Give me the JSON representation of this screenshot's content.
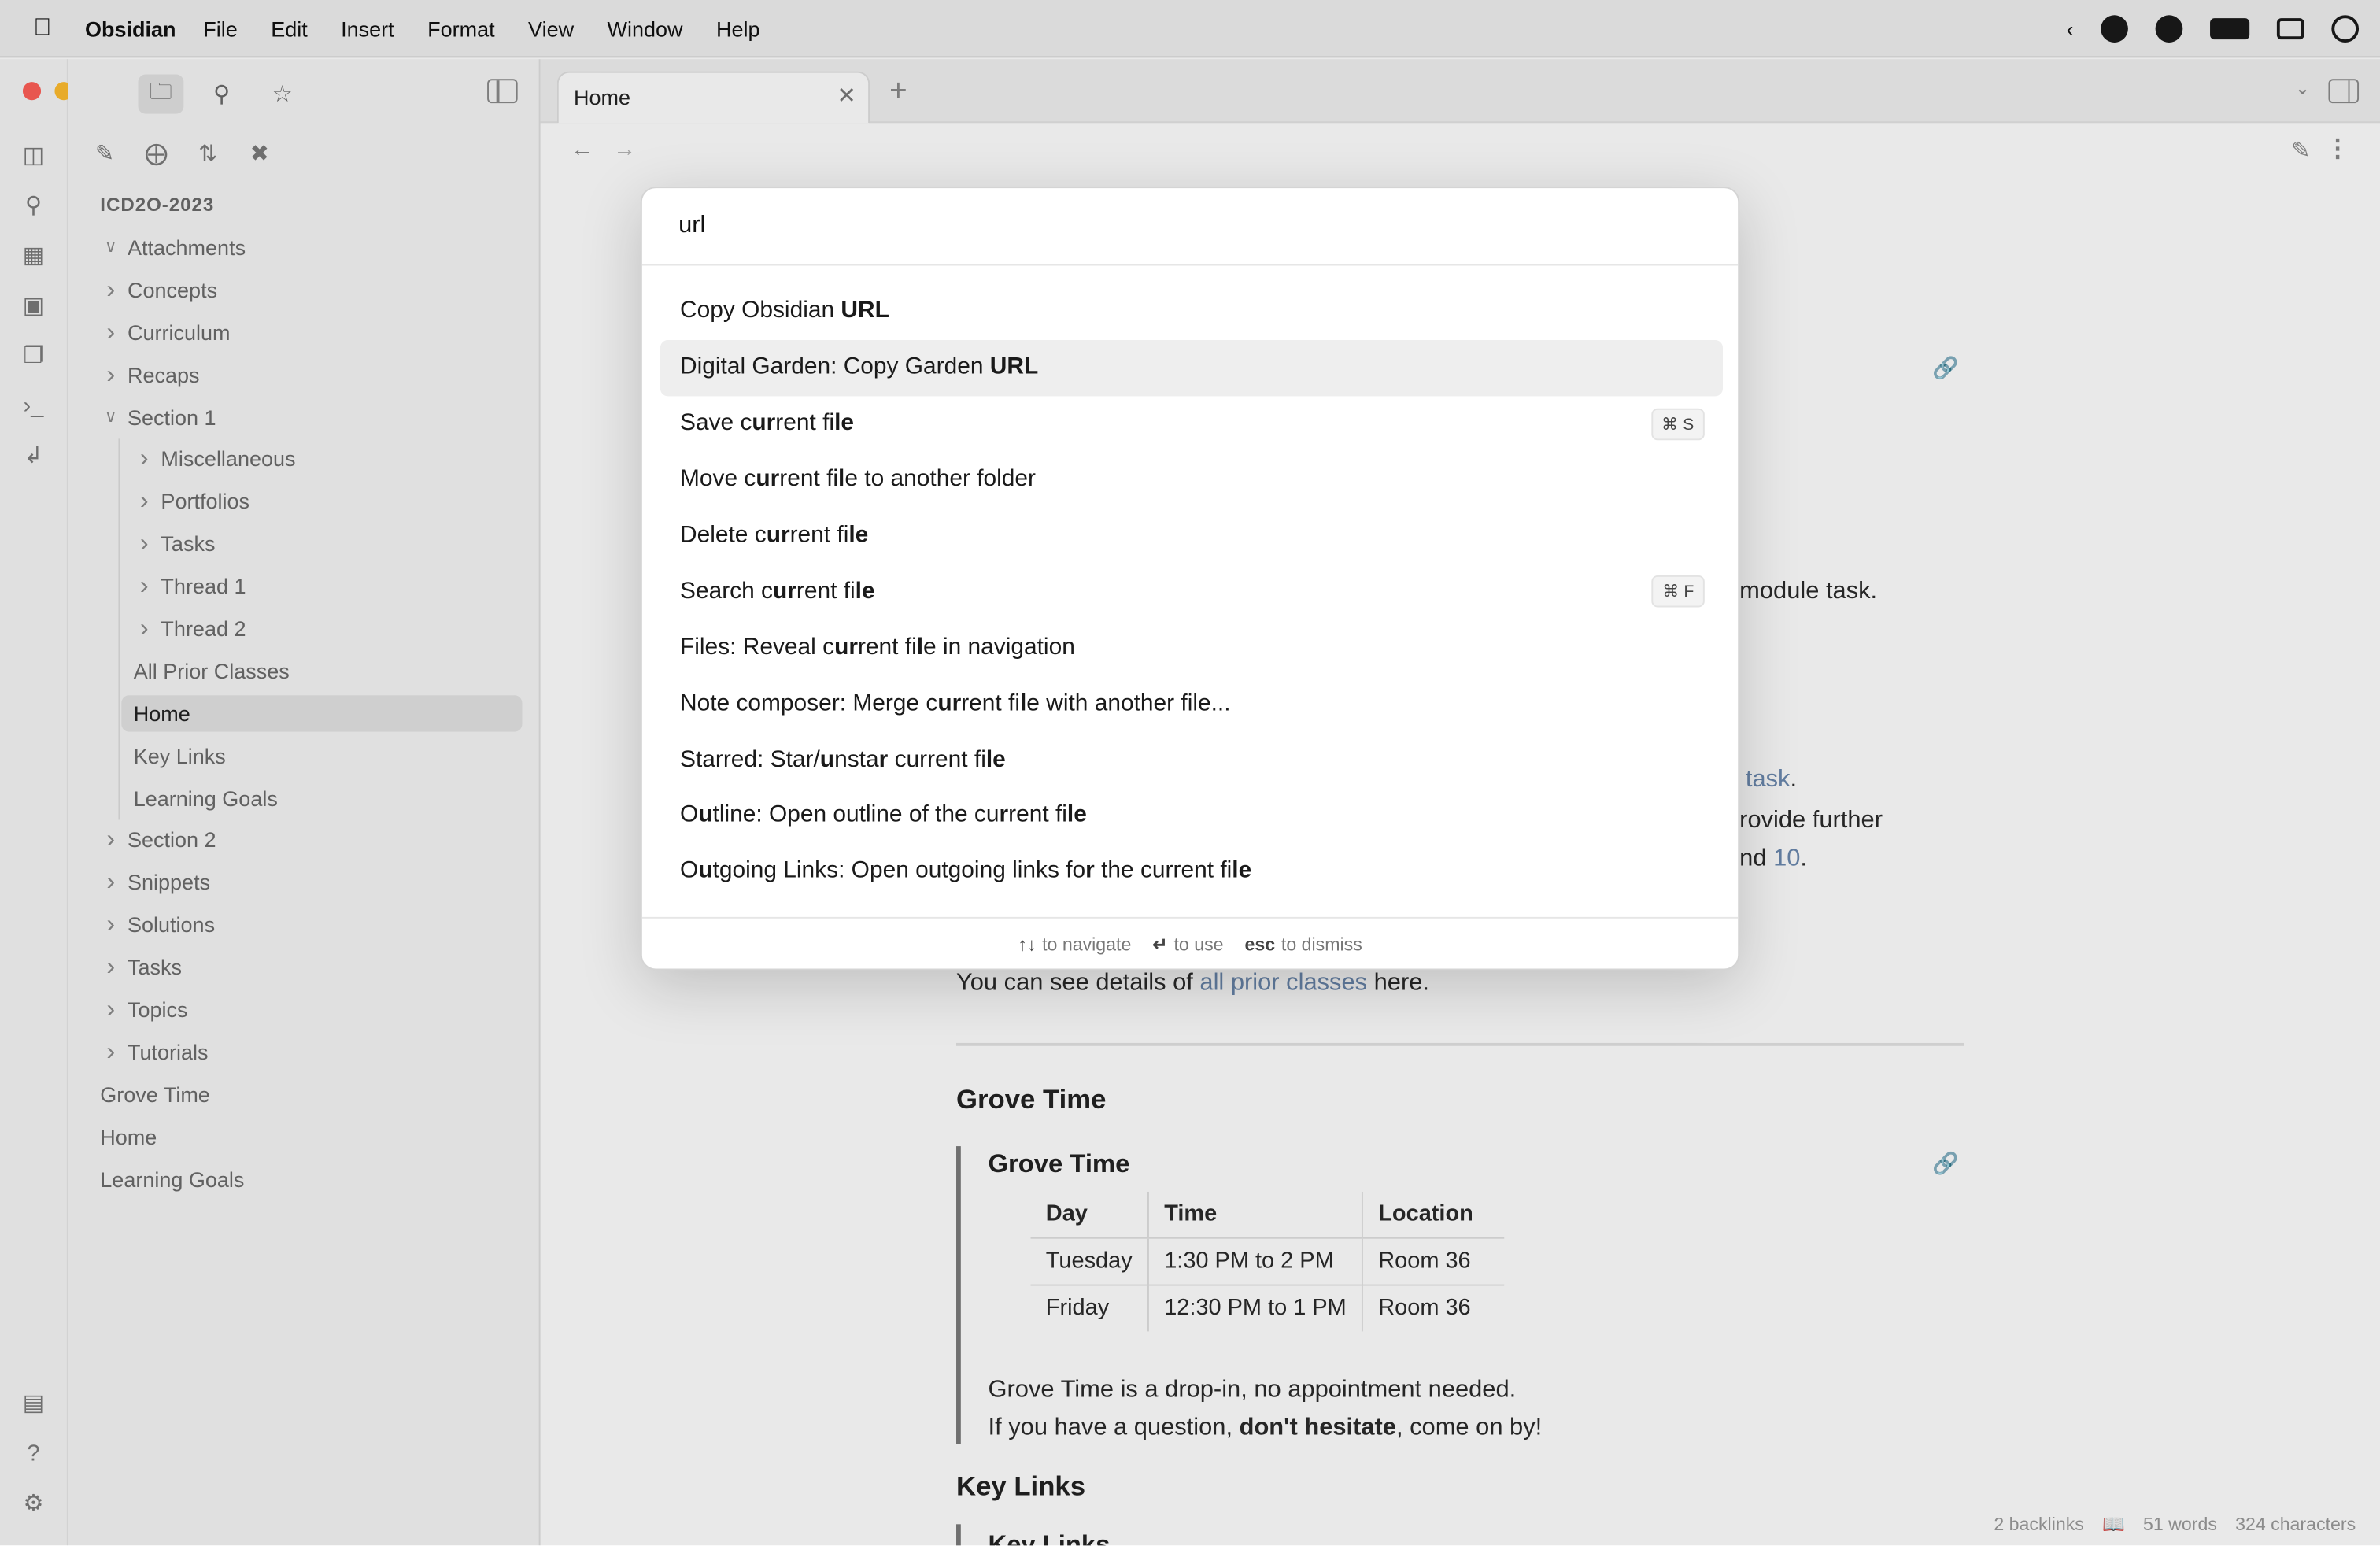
{
  "menubar": {
    "app_name": "Obsidian",
    "menus": [
      "File",
      "Edit",
      "Insert",
      "Format",
      "View",
      "Window",
      "Help"
    ]
  },
  "sidebar": {
    "vault_name": "ICD2O-2023",
    "tree": [
      {
        "label": "Attachments",
        "level": 0,
        "type": "folder",
        "expanded": true
      },
      {
        "label": "Concepts",
        "level": 0,
        "type": "folder",
        "expanded": false
      },
      {
        "label": "Curriculum",
        "level": 0,
        "type": "folder",
        "expanded": false
      },
      {
        "label": "Recaps",
        "level": 0,
        "type": "folder",
        "expanded": false
      },
      {
        "label": "Section 1",
        "level": 0,
        "type": "folder",
        "expanded": true
      },
      {
        "label": "Miscellaneous",
        "level": 1,
        "type": "folder",
        "expanded": false
      },
      {
        "label": "Portfolios",
        "level": 1,
        "type": "folder",
        "expanded": false
      },
      {
        "label": "Tasks",
        "level": 1,
        "type": "folder",
        "expanded": false
      },
      {
        "label": "Thread 1",
        "level": 1,
        "type": "folder",
        "expanded": false
      },
      {
        "label": "Thread 2",
        "level": 1,
        "type": "folder",
        "expanded": false
      },
      {
        "label": "All Prior Classes",
        "level": 1,
        "type": "file"
      },
      {
        "label": "Home",
        "level": 1,
        "type": "file",
        "selected": true
      },
      {
        "label": "Key Links",
        "level": 1,
        "type": "file"
      },
      {
        "label": "Learning Goals",
        "level": 1,
        "type": "file"
      },
      {
        "label": "Section 2",
        "level": 0,
        "type": "folder",
        "expanded": false
      },
      {
        "label": "Snippets",
        "level": 0,
        "type": "folder",
        "expanded": false
      },
      {
        "label": "Solutions",
        "level": 0,
        "type": "folder",
        "expanded": false
      },
      {
        "label": "Tasks",
        "level": 0,
        "type": "folder",
        "expanded": false
      },
      {
        "label": "Topics",
        "level": 0,
        "type": "folder",
        "expanded": false
      },
      {
        "label": "Tutorials",
        "level": 0,
        "type": "folder",
        "expanded": false
      },
      {
        "label": "Grove Time",
        "level": 0,
        "type": "file"
      },
      {
        "label": "Home",
        "level": 0,
        "type": "file"
      },
      {
        "label": "Learning Goals",
        "level": 0,
        "type": "file"
      }
    ]
  },
  "tabs": [
    {
      "label": "Home"
    }
  ],
  "palette": {
    "query": "url",
    "suggestions": [
      {
        "parts": [
          [
            "Copy Obsidian ",
            0
          ],
          [
            "URL",
            1
          ]
        ],
        "hotkey": ""
      },
      {
        "parts": [
          [
            "Digital Garden: Copy Garden ",
            0
          ],
          [
            "URL",
            1
          ]
        ],
        "hotkey": "",
        "selected": true
      },
      {
        "parts": [
          [
            "Save c",
            0
          ],
          [
            "ur",
            1
          ],
          [
            "rent fi",
            0
          ],
          [
            "le",
            1
          ]
        ],
        "hotkey": "⌘ S"
      },
      {
        "parts": [
          [
            "Move c",
            0
          ],
          [
            "ur",
            1
          ],
          [
            "rent fi",
            0
          ],
          [
            "l",
            1
          ],
          [
            "e to another folder",
            0
          ]
        ],
        "hotkey": ""
      },
      {
        "parts": [
          [
            "Delete c",
            0
          ],
          [
            "ur",
            1
          ],
          [
            "rent fi",
            0
          ],
          [
            "le",
            1
          ]
        ],
        "hotkey": ""
      },
      {
        "parts": [
          [
            "Search c",
            0
          ],
          [
            "ur",
            1
          ],
          [
            "rent fi",
            0
          ],
          [
            "le",
            1
          ]
        ],
        "hotkey": "⌘ F"
      },
      {
        "parts": [
          [
            "Files: Reveal c",
            0
          ],
          [
            "ur",
            1
          ],
          [
            "rent fi",
            0
          ],
          [
            "l",
            1
          ],
          [
            "e in navigation",
            0
          ]
        ],
        "hotkey": ""
      },
      {
        "parts": [
          [
            "Note composer: Merge c",
            0
          ],
          [
            "ur",
            1
          ],
          [
            "rent fi",
            0
          ],
          [
            "l",
            1
          ],
          [
            "e with another file...",
            0
          ]
        ],
        "hotkey": ""
      },
      {
        "parts": [
          [
            "Starred: Star/",
            0
          ],
          [
            "u",
            1
          ],
          [
            "nsta",
            0
          ],
          [
            "r",
            1
          ],
          [
            " current fi",
            0
          ],
          [
            "le",
            1
          ]
        ],
        "hotkey": ""
      },
      {
        "parts": [
          [
            "O",
            0
          ],
          [
            "u",
            1
          ],
          [
            "tline: Open outline of the cu",
            0
          ],
          [
            "r",
            1
          ],
          [
            "rent fi",
            0
          ],
          [
            "le",
            1
          ]
        ],
        "hotkey": ""
      },
      {
        "parts": [
          [
            "O",
            0
          ],
          [
            "u",
            1
          ],
          [
            "tgoing Links: Open outgoing links fo",
            0
          ],
          [
            "r",
            1
          ],
          [
            " the current fi",
            0
          ],
          [
            "le",
            1
          ]
        ],
        "hotkey": ""
      }
    ],
    "footer": [
      {
        "key": "↑↓",
        "text": "to navigate"
      },
      {
        "key": "↵",
        "text": "to use"
      },
      {
        "key": "esc",
        "text": "to dismiss"
      }
    ]
  },
  "note": {
    "frag_1": "module task.",
    "frag_2_link": "task",
    "frag_2_after": ".",
    "frag_3": "rovide further",
    "frag_4_before": "nd ",
    "frag_4_link": "10",
    "frag_4_after": ".",
    "prior_before": "You can see details of ",
    "prior_link": "all prior classes",
    "prior_after": " here.",
    "grove_heading": "Grove Time",
    "callout_title": "Grove Time",
    "table": {
      "headers": [
        "Day",
        "Time",
        "Location"
      ],
      "rows": [
        [
          "Tuesday",
          "1:30 PM to 2 PM",
          "Room 36"
        ],
        [
          "Friday",
          "12:30 PM to 1 PM",
          "Room 36"
        ]
      ]
    },
    "callout_line1": "Grove Time is a drop-in, no appointment needed.",
    "callout_line2_before": "If you have a question, ",
    "callout_line2_bold": "don't hesitate",
    "callout_line2_after": ", come on by!",
    "keylinks_heading": "Key Links",
    "keylinks_callout": "Key Links"
  },
  "status": {
    "backlinks": "2 backlinks",
    "words": "51 words",
    "characters": "324 characters"
  }
}
